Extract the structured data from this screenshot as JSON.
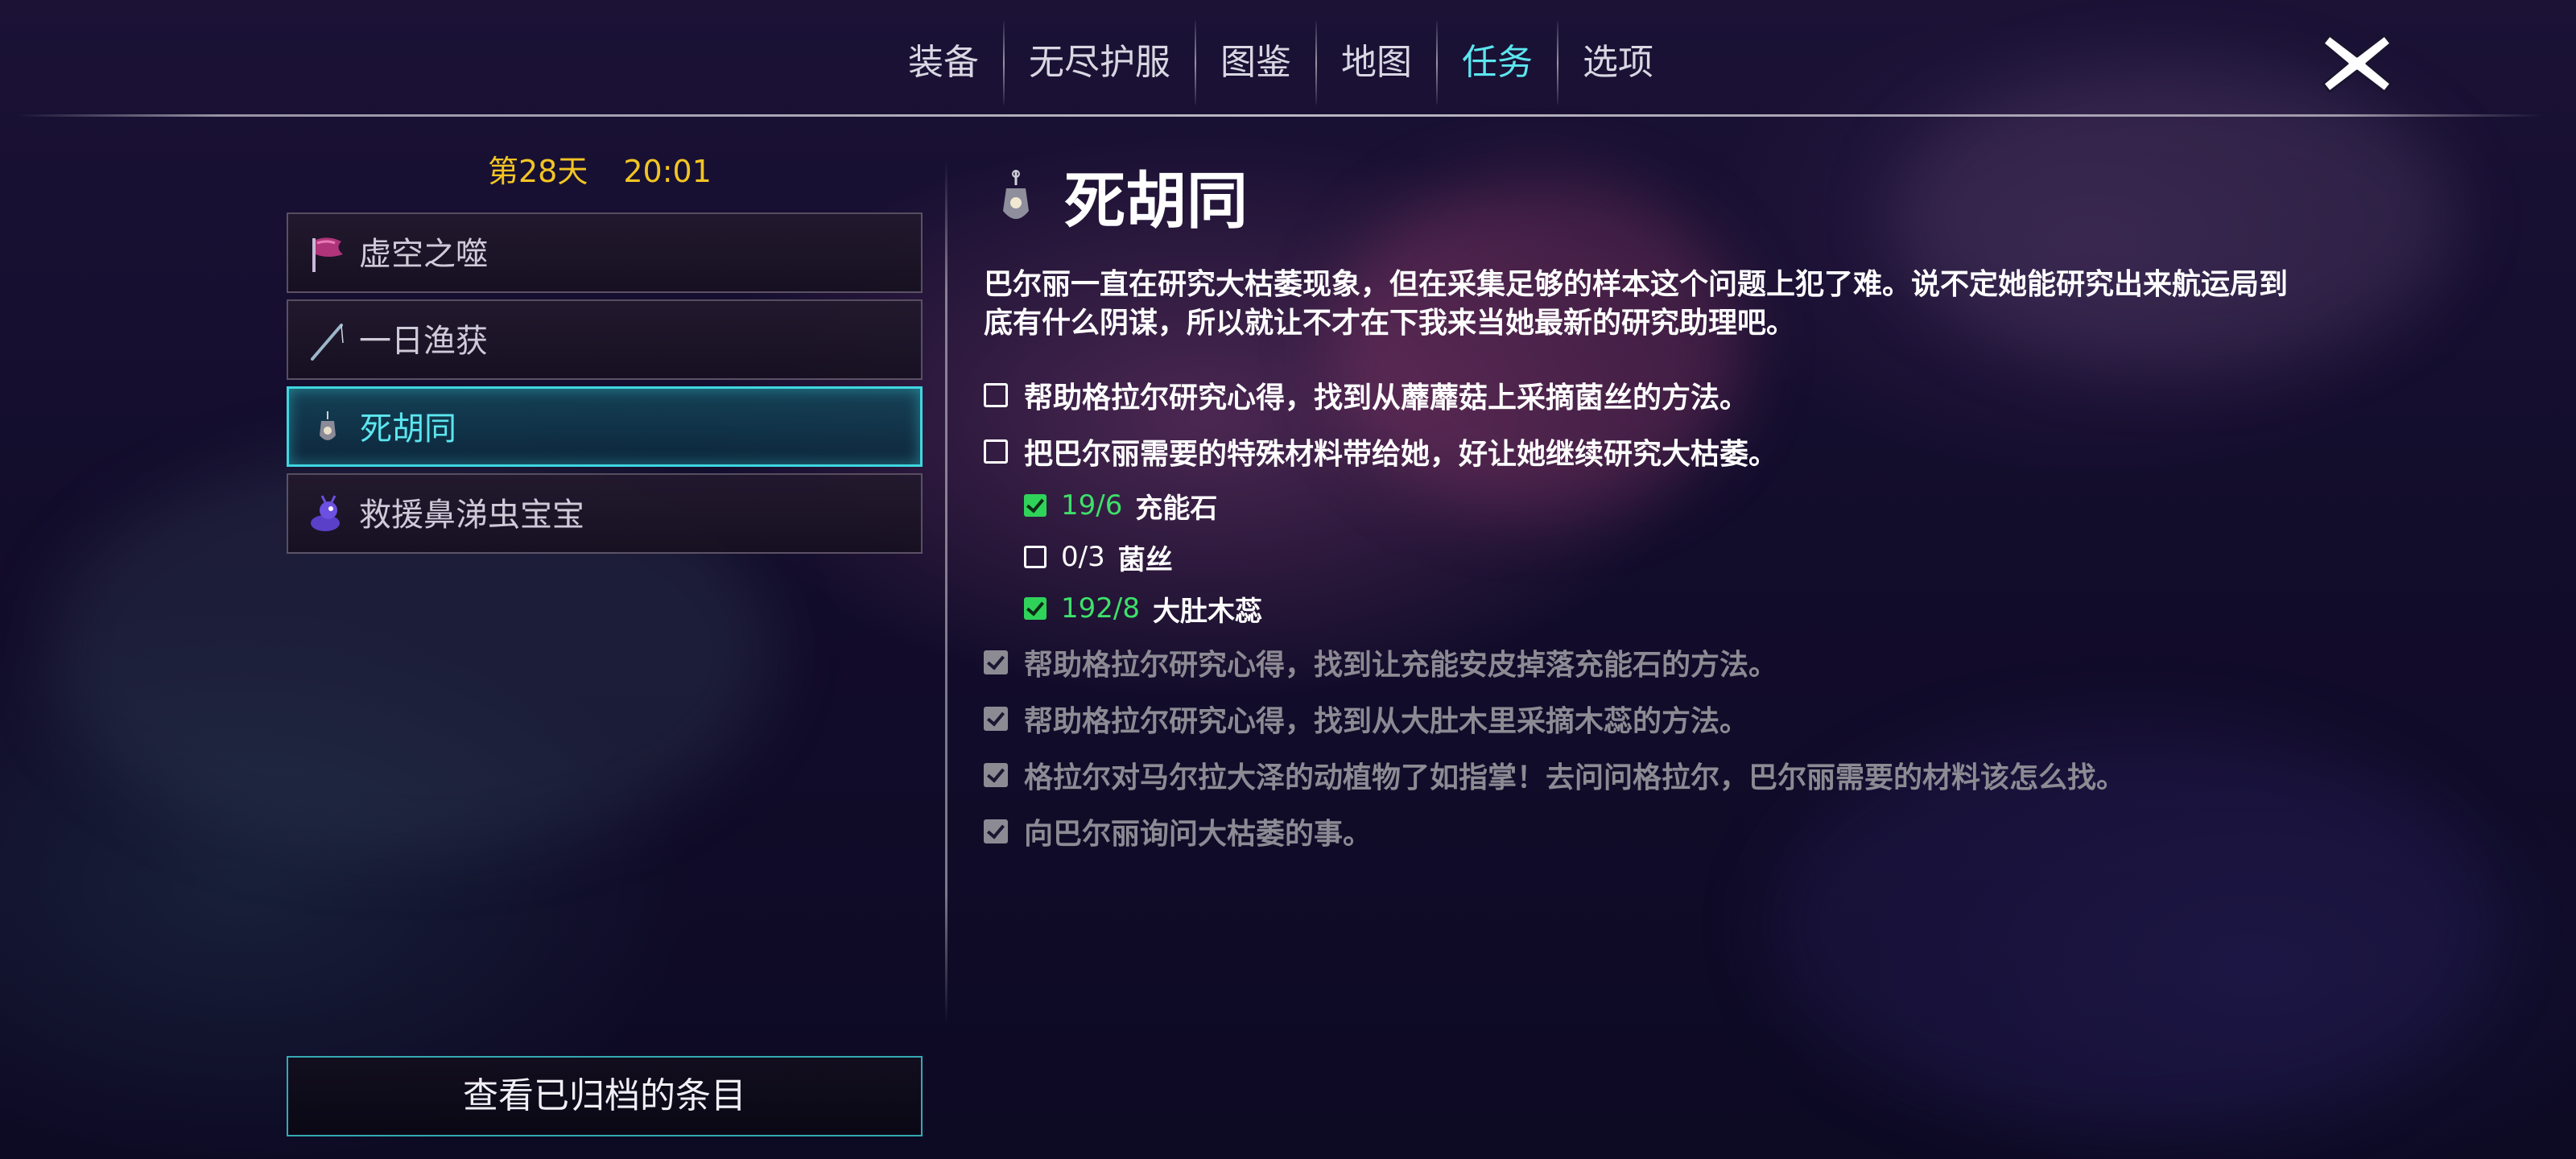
{
  "nav": {
    "tabs": [
      {
        "label": "装备"
      },
      {
        "label": "无尽护服"
      },
      {
        "label": "图鉴"
      },
      {
        "label": "地图"
      },
      {
        "label": "任务"
      },
      {
        "label": "选项"
      }
    ],
    "active_tab": "任务"
  },
  "day_info": {
    "day": "第28天",
    "time": "20:01"
  },
  "quests": [
    {
      "label": "虚空之噬",
      "icon": "flag-icon",
      "active": false
    },
    {
      "label": "一日渔获",
      "icon": "fishing-rod-icon",
      "active": false
    },
    {
      "label": "死胡同",
      "icon": "lantern-icon",
      "active": true
    },
    {
      "label": "救援鼻涕虫宝宝",
      "icon": "slug-icon",
      "active": false
    }
  ],
  "archive_button": "查看已归档的条目",
  "detail": {
    "title": "死胡同",
    "icon": "lantern-icon",
    "description": "巴尔丽一直在研究大枯萎现象，但在采集足够的样本这个问题上犯了难。说不定她能研究出来航运局到底有什么阴谋，所以就让不才在下我来当她最新的研究助理吧。",
    "objectives": [
      {
        "text": "帮助格拉尔研究心得，找到从蘼蘼菇上采摘菌丝的方法。",
        "done": false
      },
      {
        "text": "把巴尔丽需要的特殊材料带给她，好让她继续研究大枯萎。",
        "done": false
      }
    ],
    "materials": [
      {
        "count": "19/6",
        "name": "充能石",
        "done": true
      },
      {
        "count": "0/3",
        "name": "菌丝",
        "done": false
      },
      {
        "count": "192/8",
        "name": "大肚木蕊",
        "done": true
      }
    ],
    "completed": [
      {
        "text": "帮助格拉尔研究心得，找到让充能安皮掉落充能石的方法。",
        "done": true
      },
      {
        "text": "帮助格拉尔研究心得，找到从大肚木里采摘木蕊的方法。",
        "done": true
      },
      {
        "text": "格拉尔对马尔拉大泽的动植物了如指掌！去问问格拉尔，巴尔丽需要的材料该怎么找。",
        "done": true
      },
      {
        "text": "向巴尔丽询问大枯萎的事。",
        "done": true
      }
    ]
  },
  "colors": {
    "accent": "#5ce6ef",
    "day_text": "#f3c523",
    "material_ok": "#3ee06a",
    "completed_text": "#8c8a93"
  }
}
